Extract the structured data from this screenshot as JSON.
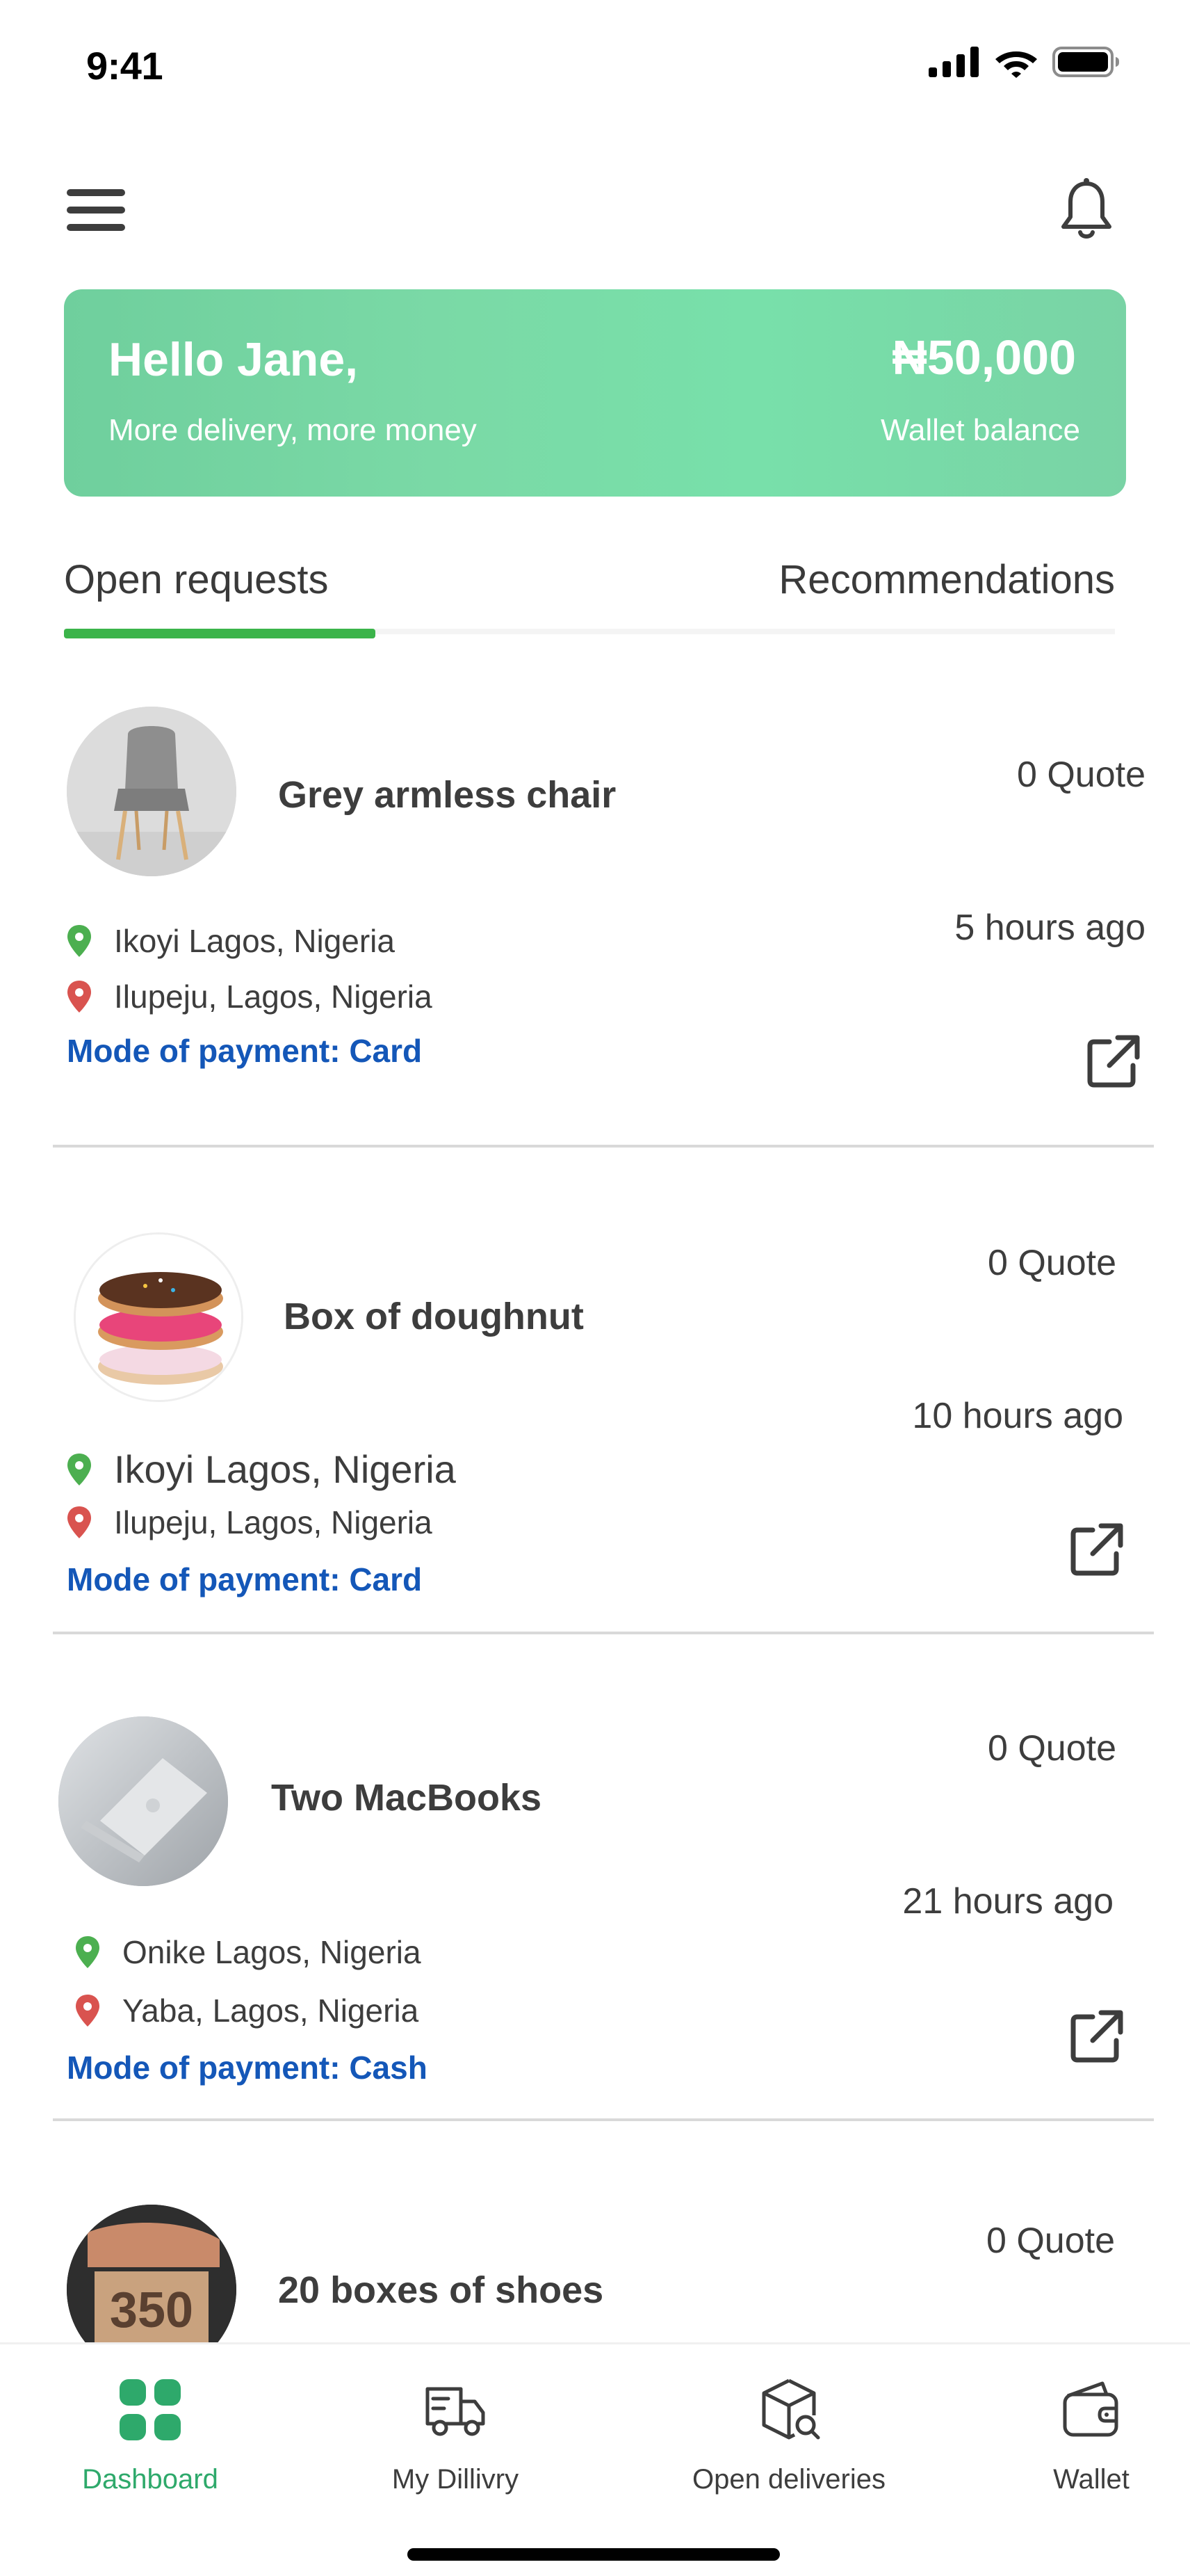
{
  "status_bar": {
    "time": "9:41"
  },
  "banner": {
    "greeting": "Hello Jane,",
    "subtitle": "More delivery, more money",
    "amount": "₦50,000",
    "amount_label": "Wallet balance"
  },
  "tabs": [
    {
      "label": "Open requests",
      "active": true
    },
    {
      "label": "Recommendations",
      "active": false
    }
  ],
  "requests": [
    {
      "title": "Grey armless chair",
      "quote": "0 Quote",
      "time": "5 hours ago",
      "pickup": "Ikoyi Lagos, Nigeria",
      "dropoff": "Ilupeju, Lagos, Nigeria",
      "payment": "Mode of payment: Card",
      "image": "grey-chair-image"
    },
    {
      "title": "Box of doughnut",
      "quote": "0 Quote",
      "time": "10 hours ago",
      "pickup": "Ikoyi Lagos, Nigeria",
      "dropoff": "Ilupeju, Lagos, Nigeria",
      "payment": "Mode of payment: Card",
      "image": "doughnuts-image"
    },
    {
      "title": "Two MacBooks",
      "quote": "0 Quote",
      "time": "21 hours ago",
      "pickup": "Onike Lagos, Nigeria",
      "dropoff": "Yaba, Lagos, Nigeria",
      "payment": "Mode of payment: Cash",
      "image": "macbook-image"
    },
    {
      "title": "20 boxes of shoes",
      "quote": "0 Quote",
      "image": "shoes-box-image"
    }
  ],
  "bottom_nav": [
    {
      "label": "Dashboard",
      "icon": "dashboard-grid-icon",
      "active": true
    },
    {
      "label": "My Dillivry",
      "icon": "delivery-truck-icon",
      "active": false
    },
    {
      "label": "Open deliveries",
      "icon": "box-search-icon",
      "active": false
    },
    {
      "label": "Wallet",
      "icon": "wallet-icon",
      "active": false
    }
  ],
  "colors": {
    "accent_green": "#3bb44a",
    "banner_green": "#78dba8",
    "payment_blue": "#1457b8",
    "pickup_pin": "#4caf50",
    "dropoff_pin": "#d9534f"
  }
}
